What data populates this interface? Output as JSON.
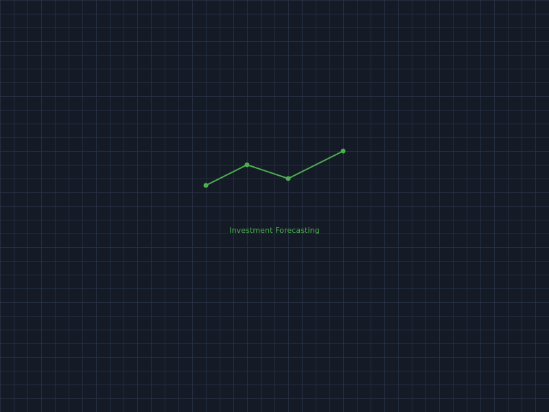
{
  "splash": {
    "caption": "Investment Forecasting",
    "accent_color": "#4caf50",
    "background_color": "#151b26",
    "grid_color": "#2a3548",
    "graphic_icon": "rising-trend-line-icon"
  }
}
